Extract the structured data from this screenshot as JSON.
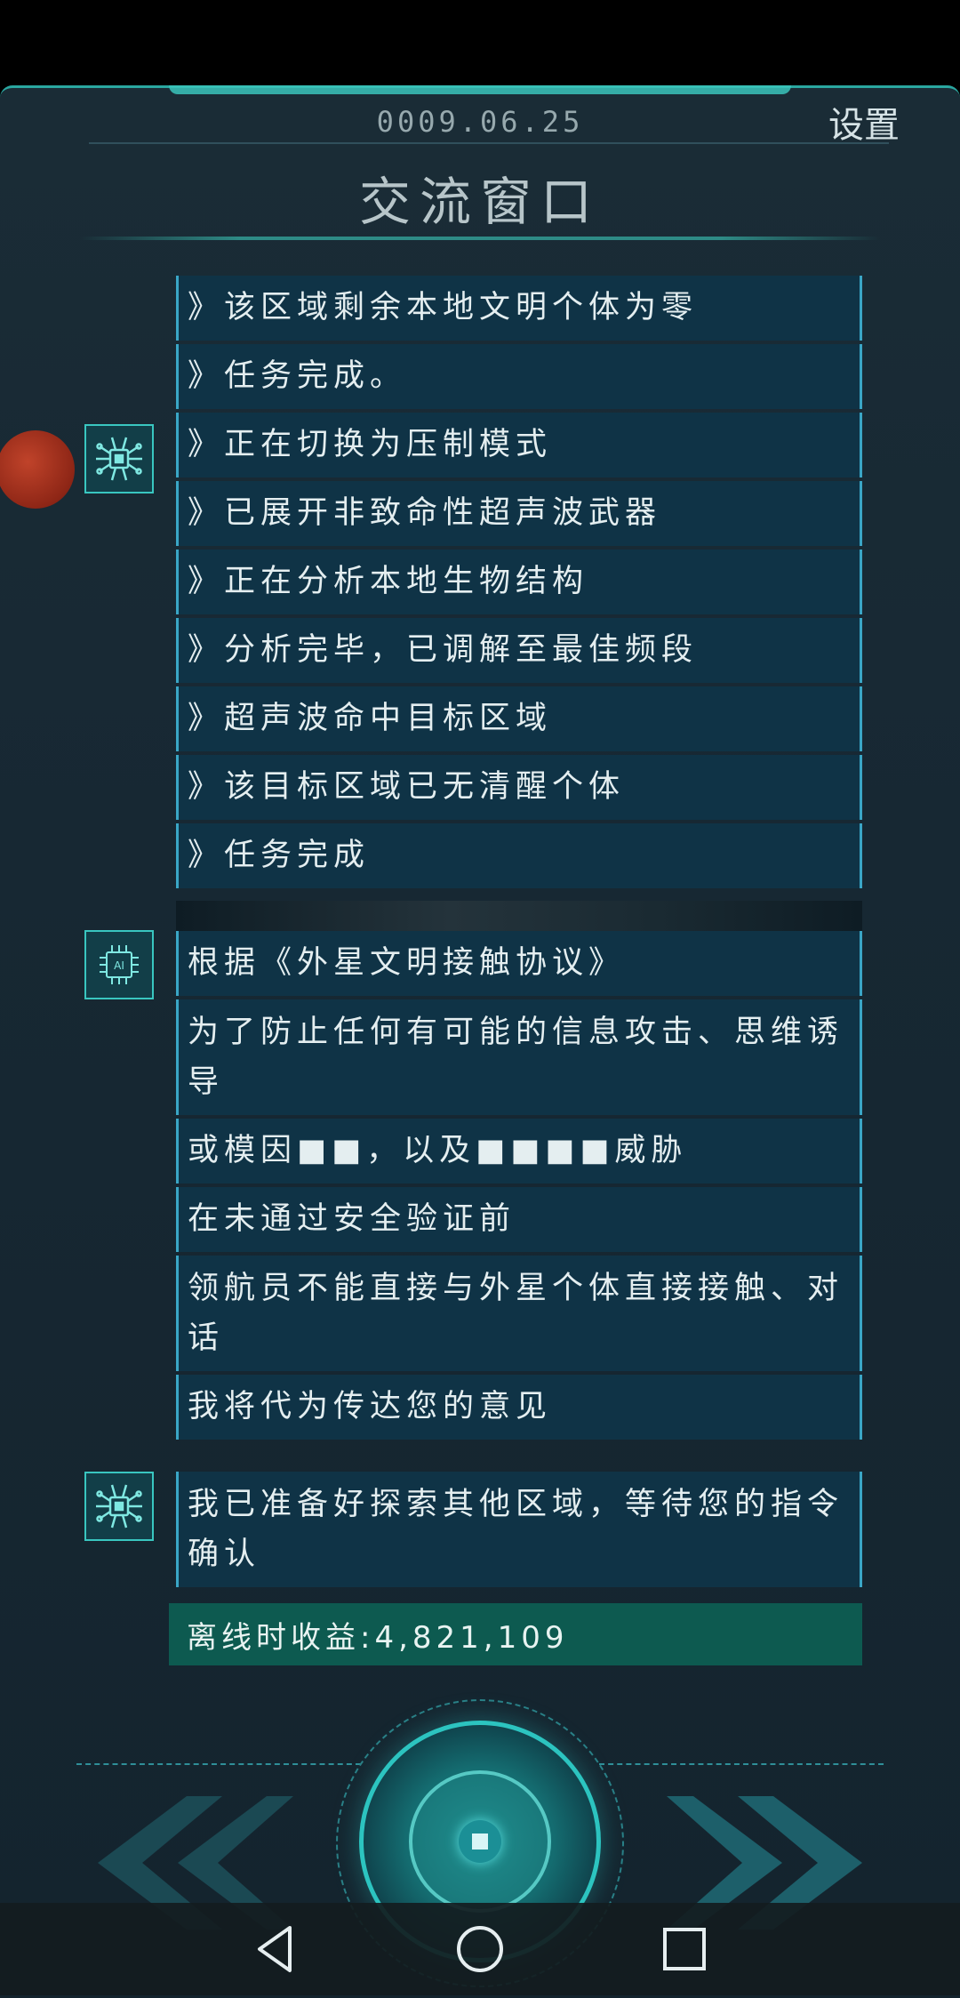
{
  "header": {
    "date": "0009.06.25",
    "settings_label": "设置",
    "title": "交流窗口"
  },
  "feed": {
    "robot_messages": [
      "》该区域剩余本地文明个体为零",
      "》任务完成。",
      "》正在切换为压制模式",
      "》已展开非致命性超声波武器",
      "》正在分析本地生物结构",
      "》分析完毕，已调解至最佳频段",
      "》超声波命中目标区域",
      "》该目标区域已无清醒个体",
      "》任务完成"
    ],
    "ai_messages": [
      "根据《外星文明接触协议》",
      "为了防止任何有可能的信息攻击、思维诱导",
      "或模因■■，以及■■■■威胁",
      "在未通过安全验证前",
      "领航员不能直接与外星个体直接接触、对话",
      "我将代为传达您的意见"
    ],
    "robot_final_message": "我已准备好探索其他区域，等待您的指令确认",
    "offline_earnings": "离线时收益:4,821,109"
  },
  "icons": {
    "robot_avatar": "chip-spider-icon",
    "ai_avatar": "ai-chip-icon",
    "prev": "double-chevron-left-icon",
    "next": "double-chevron-right-icon",
    "center": "action-core-button",
    "nav_back": "triangle-back-icon",
    "nav_home": "circle-home-icon",
    "nav_recents": "square-recents-icon"
  },
  "colors": {
    "panel_bg": "#172833",
    "message_bg": "#0f3346",
    "accent": "#2cc4c0",
    "earnings_bg": "#0d5a50"
  }
}
